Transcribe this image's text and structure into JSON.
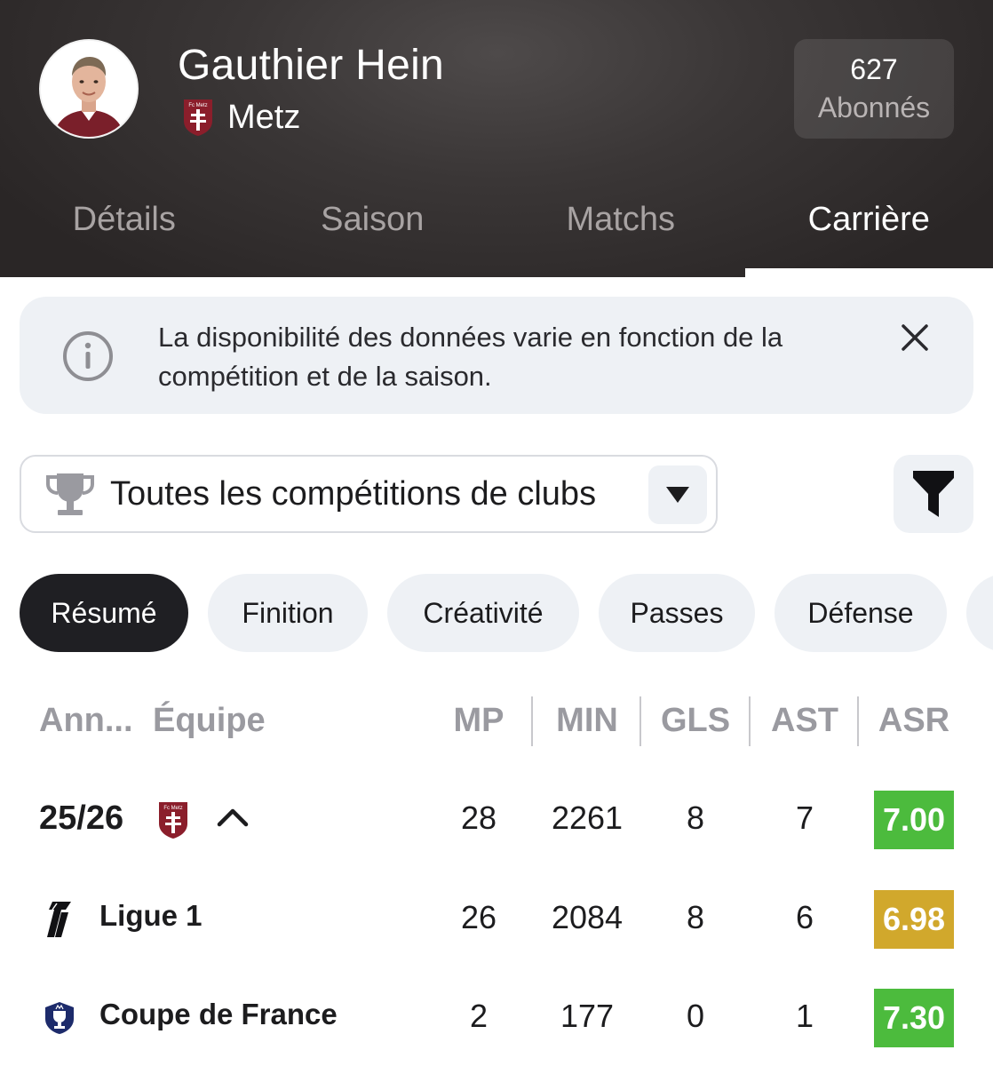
{
  "header": {
    "player_name": "Gauthier Hein",
    "club": {
      "name": "Metz",
      "crest_text": "Fc Metz"
    },
    "followers": {
      "count": "627",
      "label": "Abonnés"
    },
    "tabs": [
      {
        "label": "Détails",
        "active": false
      },
      {
        "label": "Saison",
        "active": false
      },
      {
        "label": "Matchs",
        "active": false
      },
      {
        "label": "Carrière",
        "active": true
      }
    ]
  },
  "info_banner": {
    "icon": "info-icon",
    "text": "La disponibilité des données varie en fonction de la compétition et de la saison.",
    "close_icon": "close-icon"
  },
  "competition_filter": {
    "icon": "trophy-icon",
    "selected": "Toutes les compétitions de clubs",
    "arrow_icon": "caret-down-icon",
    "filter_icon": "funnel-icon"
  },
  "chips": [
    {
      "label": "Résumé",
      "active": true
    },
    {
      "label": "Finition",
      "active": false
    },
    {
      "label": "Créativité",
      "active": false
    },
    {
      "label": "Passes",
      "active": false
    },
    {
      "label": "Défense",
      "active": false
    }
  ],
  "table": {
    "columns": {
      "year": "Ann...",
      "team": "Équipe",
      "mp": "MP",
      "min": "MIN",
      "gls": "GLS",
      "ast": "AST",
      "asr": "ASR"
    },
    "season_row": {
      "season": "25/26",
      "crest_text": "Fc Metz",
      "expand_icon": "chevron-up-icon",
      "mp": "28",
      "min": "2261",
      "gls": "8",
      "ast": "7",
      "asr": "7.00",
      "asr_color": "#4cbb3d"
    },
    "competition_rows": [
      {
        "name": "Ligue 1",
        "icon": "ligue1-logo",
        "mp": "26",
        "min": "2084",
        "gls": "8",
        "ast": "6",
        "asr": "6.98",
        "asr_color": "#d1a82c"
      },
      {
        "name": "Coupe de France",
        "icon": "coupe-de-france-logo",
        "mp": "2",
        "min": "177",
        "gls": "0",
        "ast": "1",
        "asr": "7.30",
        "asr_color": "#4cbb3d"
      }
    ]
  },
  "colors": {
    "header_bg": "#3a3636",
    "chip_active": "#1f1f23",
    "banner_bg": "#eef1f5",
    "metz_red": "#8b1e2b",
    "rating_green": "#4cbb3d",
    "rating_gold": "#d1a82c"
  }
}
